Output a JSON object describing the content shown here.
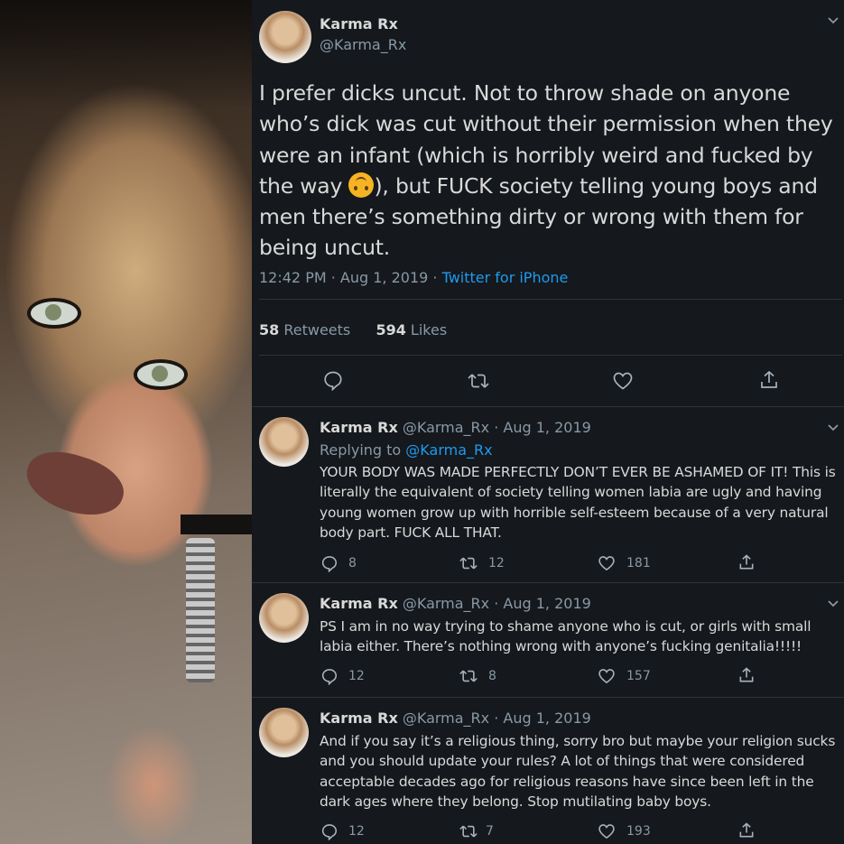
{
  "main_tweet": {
    "name": "Karma Rx",
    "handle": "@Karma_Rx",
    "text_before_emoji": "I prefer dicks uncut. Not to throw shade on anyone who’s dick was cut without their permission when they were an infant (which is horribly weird and fucked by the way ",
    "emoji": "upside-down-face-emoji",
    "text_after_emoji": "), but FUCK society telling young boys and men there’s something dirty or wrong with them for being uncut.",
    "time": "12:42 PM · Aug 1, 2019 · ",
    "source": "Twitter for iPhone",
    "retweets": "58",
    "retweets_label": " Retweets",
    "likes": "594",
    "likes_label": " Likes"
  },
  "replies": [
    {
      "name": "Karma Rx",
      "handle_date": " @Karma_Rx · Aug 1, 2019",
      "replying_label": "Replying to ",
      "replying_to": "@Karma_Rx",
      "text": "YOUR BODY WAS MADE PERFECTLY DON’T EVER BE ASHAMED OF IT! This is literally the equivalent of society telling women labia are ugly and having young women grow up with horrible self-esteem because of a very natural body part. FUCK ALL THAT.",
      "reply_count": "8",
      "retweet_count": "12",
      "like_count": "181"
    },
    {
      "name": "Karma Rx",
      "handle_date": " @Karma_Rx · Aug 1, 2019",
      "text": "PS I am in no way trying to shame anyone who is cut, or girls with small labia either. There’s nothing wrong with anyone’s fucking genitalia!!!!!",
      "reply_count": "12",
      "retweet_count": "8",
      "like_count": "157"
    },
    {
      "name": "Karma Rx",
      "handle_date": " @Karma_Rx · Aug 1, 2019",
      "text": "And if you say it’s a religious thing, sorry bro but maybe your religion sucks and you should update your rules? A lot of things that were considered acceptable decades ago for religious reasons have since been left in the dark ages where they belong. Stop mutilating baby boys.",
      "reply_count": "12",
      "retweet_count": "7",
      "like_count": "193"
    }
  ],
  "colors": {
    "background": "#15181c",
    "text": "#d9d9d9",
    "secondary": "#8899a6",
    "link": "#1d9bf0"
  }
}
